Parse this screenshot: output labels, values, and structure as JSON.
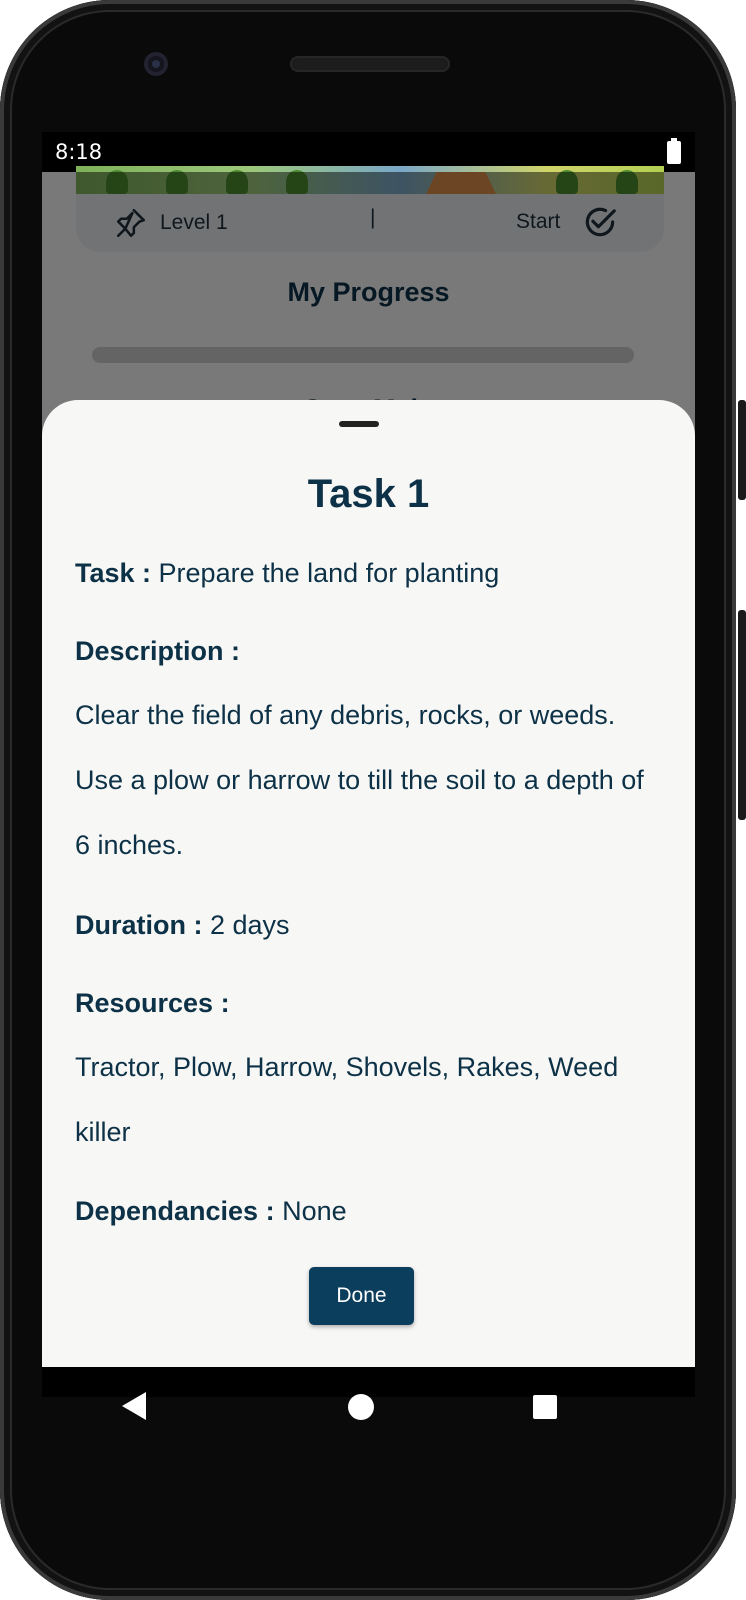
{
  "status_bar": {
    "time": "8:18"
  },
  "level_card": {
    "level_label": "Level 1",
    "separator": "|",
    "start_label": "Start"
  },
  "progress": {
    "title": "My Progress",
    "value": 0
  },
  "background_heading": "Crop Main",
  "sheet": {
    "title": "Task 1",
    "task": {
      "label": "Task :",
      "value": " Prepare the land for planting"
    },
    "description": {
      "label": "Description :",
      "value": "Clear the field of any debris, rocks, or weeds. Use a plow or harrow to till the soil to a depth of 6 inches."
    },
    "duration": {
      "label": "Duration :",
      "value": " 2 days"
    },
    "resources": {
      "label": "Resources :",
      "value": "Tractor, Plow, Harrow, Shovels, Rakes, Weed killer"
    },
    "dependencies": {
      "label": "Dependancies :",
      "value": " None"
    },
    "done_label": "Done"
  },
  "colors": {
    "primary": "#0b3d5c",
    "heading": "#0d3146",
    "sheet_bg": "#f7f7f6"
  },
  "icons": [
    "pin-icon",
    "check-circle-icon",
    "battery-icon",
    "nav-back-icon",
    "nav-home-icon",
    "nav-recents-icon"
  ]
}
